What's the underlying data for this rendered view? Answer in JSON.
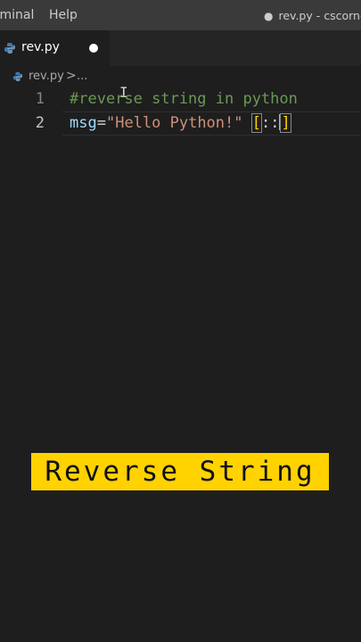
{
  "menubar": {
    "terminal_label": "rminal",
    "help_label": "Help",
    "window_title": "rev.py - cscorner"
  },
  "tab": {
    "file_name": "rev.py",
    "unsaved": true
  },
  "breadcrumb": {
    "file": "rev.py",
    "separator": ">",
    "more": "..."
  },
  "editor": {
    "lines": [
      {
        "number": "1",
        "comment": "#reverse string in python"
      },
      {
        "number": "2",
        "var": "msg",
        "op": "=",
        "str": "\"Hello Python!\"",
        "space": " ",
        "open_bracket": "[",
        "colons": "::",
        "close_bracket": "]"
      }
    ]
  },
  "banner": {
    "text": "Reverse String",
    "background": "#ffd200"
  },
  "colors": {
    "comment": "#6a9955",
    "variable": "#9cdcfe",
    "string": "#ce9178",
    "bracket": "#ffd700"
  }
}
